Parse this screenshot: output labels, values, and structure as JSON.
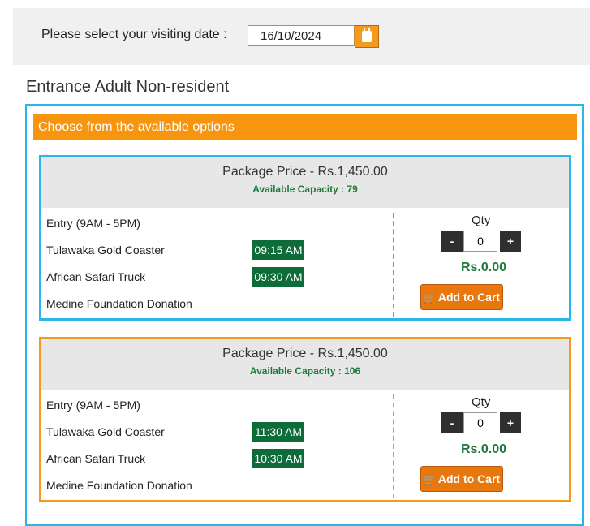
{
  "date_selector": {
    "label": "Please select your visiting date :",
    "value": "16/10/2024",
    "calendar_icon": "calendar-icon"
  },
  "section_title": "Entrance Adult Non-resident",
  "options_banner": "Choose from the available options",
  "packages": [
    {
      "price": "Package Price - Rs.1,450.00",
      "capacity": "Available Capacity : 79",
      "items": [
        {
          "name": "Entry (9AM - 5PM)",
          "time": ""
        },
        {
          "name": "Tulawaka Gold Coaster",
          "time": "09:15 AM"
        },
        {
          "name": "African Safari Truck",
          "time": "09:30 AM"
        },
        {
          "name": "Medine Foundation Donation",
          "time": ""
        }
      ],
      "qty_label": "Qty",
      "qty_value": "0",
      "minus": "-",
      "plus": "+",
      "subtotal": "Rs.0.00",
      "add_to_cart": "Add to Cart",
      "border_color": "#29b6e8"
    },
    {
      "price": "Package Price - Rs.1,450.00",
      "capacity": "Available Capacity : 106",
      "items": [
        {
          "name": "Entry (9AM - 5PM)",
          "time": ""
        },
        {
          "name": "Tulawaka Gold Coaster",
          "time": "11:30 AM"
        },
        {
          "name": "African Safari Truck",
          "time": "10:30 AM"
        },
        {
          "name": "Medine Foundation Donation",
          "time": ""
        }
      ],
      "qty_label": "Qty",
      "qty_value": "0",
      "minus": "-",
      "plus": "+",
      "subtotal": "Rs.0.00",
      "add_to_cart": "Add to Cart",
      "border_color": "#f39a1f"
    }
  ],
  "colors": {
    "accent_orange": "#f7960e",
    "accent_blue": "#29b6e8",
    "badge_green": "#0e6b3a"
  }
}
